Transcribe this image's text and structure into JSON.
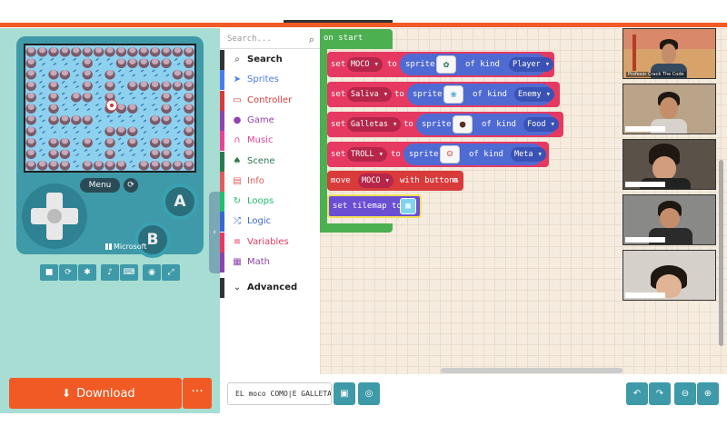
{
  "toolbox": {
    "search_placeholder": "Search...",
    "categories": [
      {
        "label": "Search",
        "color": "#333333",
        "icon": "search-icon"
      },
      {
        "label": "Sprites",
        "color": "#4b7bec",
        "icon": "paper-plane-icon"
      },
      {
        "label": "Controller",
        "color": "#d93b3b",
        "icon": "gamepad-icon"
      },
      {
        "label": "Game",
        "color": "#8e44ad",
        "icon": "circle-icon"
      },
      {
        "label": "Music",
        "color": "#e84393",
        "icon": "headphones-icon"
      },
      {
        "label": "Scene",
        "color": "#2d7a4f",
        "icon": "tree-icon"
      },
      {
        "label": "Info",
        "color": "#e05d5d",
        "icon": "id-card-icon"
      },
      {
        "label": "Loops",
        "color": "#20bf6b",
        "icon": "loop-icon"
      },
      {
        "label": "Logic",
        "color": "#3867d6",
        "icon": "shuffle-icon"
      },
      {
        "label": "Variables",
        "color": "#e63962",
        "icon": "list-icon"
      },
      {
        "label": "Math",
        "color": "#8e44ad",
        "icon": "calculator-icon"
      },
      {
        "label": "Advanced",
        "color": "#333333",
        "icon": "chevron-down-icon"
      }
    ]
  },
  "simulator": {
    "menu_label": "Menu",
    "a_label": "A",
    "b_label": "B",
    "brand_label": "Microsoft"
  },
  "download": {
    "label": "Download",
    "more_label": "···"
  },
  "blocks": {
    "on_start": "on start",
    "set_rows": [
      {
        "var": "MOCO",
        "sprite_icon": "cactus-sprite",
        "kind": "Player"
      },
      {
        "var": "Saliva",
        "sprite_icon": "flower-sprite",
        "kind": "Enemy"
      },
      {
        "var": "Galletas",
        "sprite_icon": "cookie-sprite",
        "kind": "Food"
      },
      {
        "var": "TROLL",
        "sprite_icon": "face-sprite",
        "kind": "Meta"
      }
    ],
    "set_word": "set",
    "to_word": "to",
    "sprite_word": "sprite",
    "of_kind_word": "of kind",
    "move_word": "move",
    "move_var": "MOCO",
    "with_buttons": "with buttons",
    "set_tilemap": "set tilemap to"
  },
  "video": {
    "first_name": "Profesor Crack The Code"
  },
  "bottom": {
    "project_name": "EL moco COMO|E GALLETA"
  }
}
